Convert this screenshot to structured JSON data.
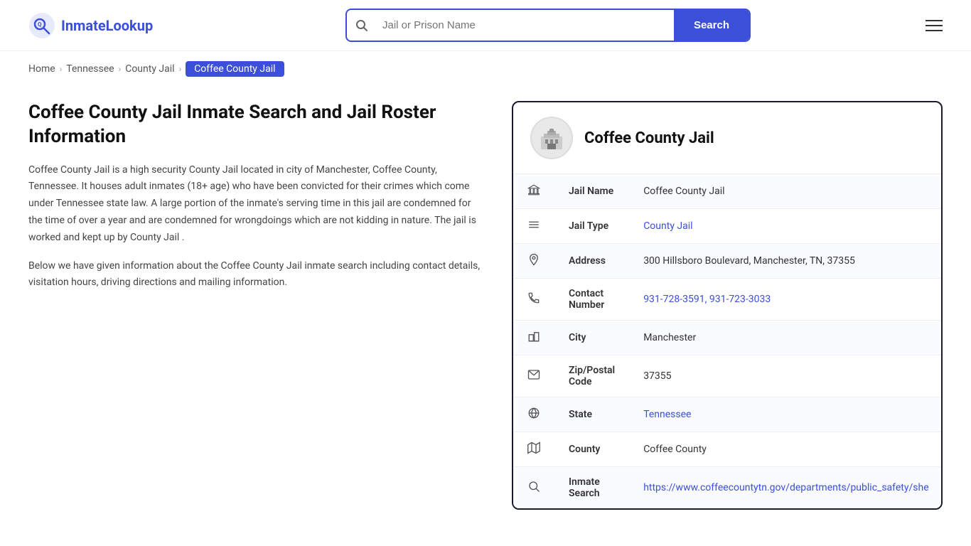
{
  "header": {
    "logo_text_regular": "Inmate",
    "logo_text_bold": "Lookup",
    "search_placeholder": "Jail or Prison Name",
    "search_button_label": "Search"
  },
  "breadcrumb": {
    "items": [
      {
        "label": "Home",
        "href": "#"
      },
      {
        "label": "Tennessee",
        "href": "#"
      },
      {
        "label": "County Jail",
        "href": "#"
      }
    ],
    "active": "Coffee County Jail"
  },
  "left": {
    "title": "Coffee County Jail Inmate Search and Jail Roster Information",
    "description1": "Coffee County Jail is a high security County Jail located in city of Manchester, Coffee County, Tennessee. It houses adult inmates (18+ age) who have been convicted for their crimes which come under Tennessee state law. A large portion of the inmate's serving time in this jail are condemned for the time of over a year and are condemned for wrongdoings which are not kidding in nature. The jail is worked and kept up by County Jail .",
    "description2": "Below we have given information about the Coffee County Jail inmate search including contact details, visitation hours, driving directions and mailing information."
  },
  "card": {
    "title": "Coffee County Jail",
    "rows": [
      {
        "icon": "🏛",
        "label": "Jail Name",
        "value": "Coffee County Jail",
        "is_link": false,
        "href": ""
      },
      {
        "icon": "≡",
        "label": "Jail Type",
        "value": "County Jail",
        "is_link": true,
        "href": "#"
      },
      {
        "icon": "📍",
        "label": "Address",
        "value": "300 Hillsboro Boulevard, Manchester, TN, 37355",
        "is_link": false,
        "href": ""
      },
      {
        "icon": "📞",
        "label": "Contact Number",
        "value": "931-728-3591, 931-723-3033",
        "is_link": true,
        "href": "tel:9317283591"
      },
      {
        "icon": "🏙",
        "label": "City",
        "value": "Manchester",
        "is_link": false,
        "href": ""
      },
      {
        "icon": "✉",
        "label": "Zip/Postal Code",
        "value": "37355",
        "is_link": false,
        "href": ""
      },
      {
        "icon": "🌐",
        "label": "State",
        "value": "Tennessee",
        "is_link": true,
        "href": "#"
      },
      {
        "icon": "🗺",
        "label": "County",
        "value": "Coffee County",
        "is_link": false,
        "href": ""
      },
      {
        "icon": "🔍",
        "label": "Inmate Search",
        "value": "https://www.coffeecountytn.gov/departments/public_safety/she",
        "is_link": true,
        "href": "https://www.coffeecountytn.gov/departments/public_safety/she"
      }
    ]
  }
}
